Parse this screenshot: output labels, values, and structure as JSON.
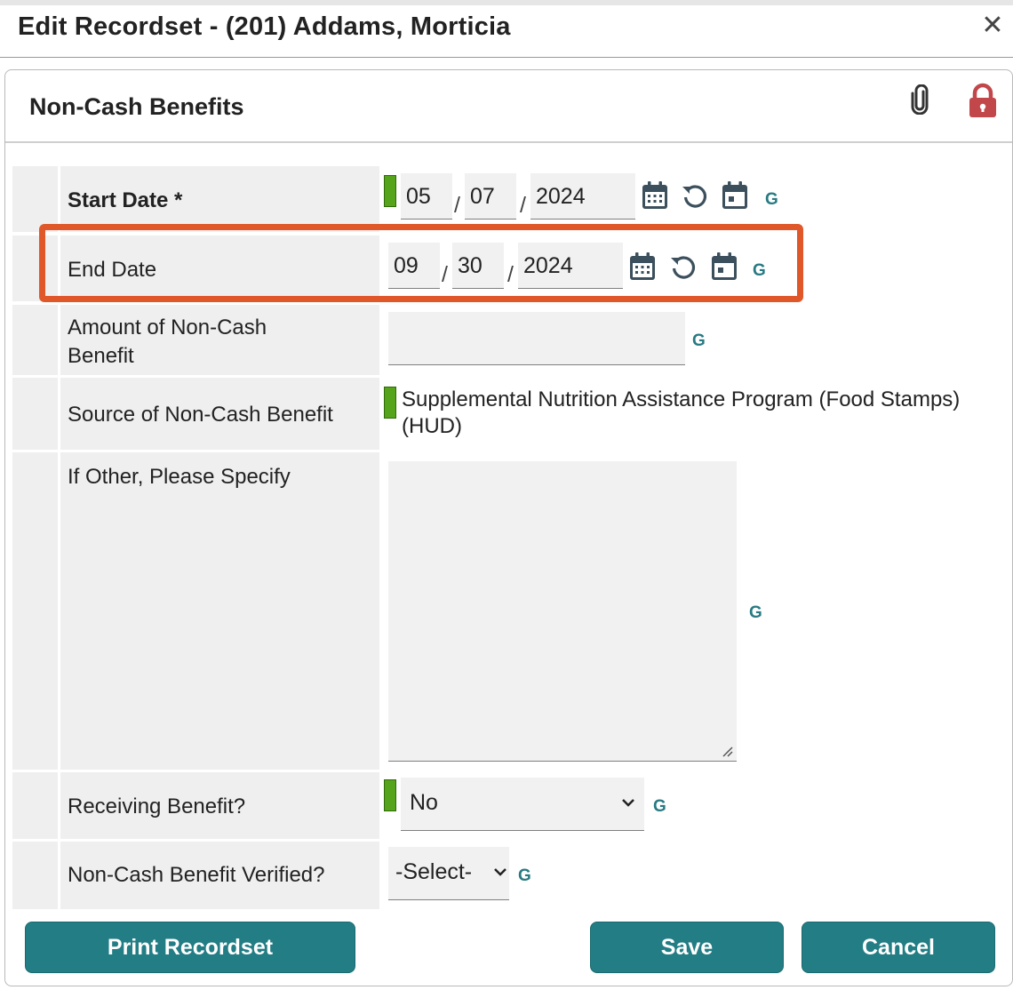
{
  "dialog": {
    "title": "Edit Recordset - (201) Addams, Morticia",
    "close_symbol": "✕"
  },
  "panel": {
    "title": "Non-Cash Benefits",
    "icons": [
      "paperclip-icon",
      "lock-icon"
    ]
  },
  "fields": {
    "start_date": {
      "label": "Start Date *",
      "month": "05",
      "day": "07",
      "year": "2024",
      "g": "G"
    },
    "end_date": {
      "label": "End Date",
      "month": "09",
      "day": "30",
      "year": "2024",
      "g": "G"
    },
    "amount": {
      "label": "Amount of Non-Cash Benefit",
      "value": "",
      "g": "G"
    },
    "source": {
      "label": "Source of Non-Cash Benefit",
      "value": "Supplemental Nutrition Assistance Program (Food Stamps) (HUD)"
    },
    "other": {
      "label": "If Other, Please Specify",
      "value": "",
      "g": "G"
    },
    "receiving": {
      "label": "Receiving Benefit?",
      "value": "No",
      "g": "G"
    },
    "verified": {
      "label": "Non-Cash Benefit Verified?",
      "value": "-Select-",
      "g": "G"
    }
  },
  "date_separator": "/",
  "buttons": {
    "print": "Print Recordset",
    "save": "Save",
    "cancel": "Cancel"
  },
  "colors": {
    "accent": "#237d84",
    "required": "#56a31c",
    "lock": "#c2474b",
    "highlight": "#e0582a"
  }
}
